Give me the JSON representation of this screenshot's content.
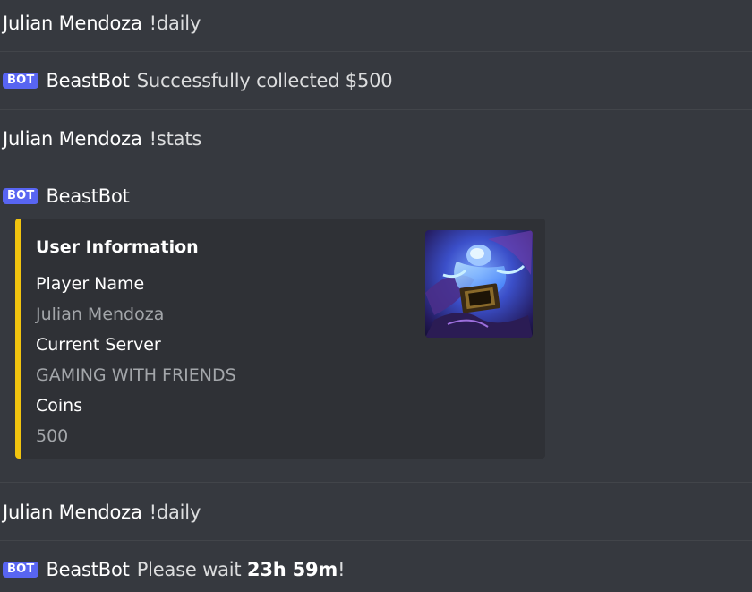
{
  "messages": [
    {
      "author": "Julian Mendoza",
      "text": "!daily"
    },
    {
      "bot_tag": "BOT",
      "author": "BeastBot",
      "text": "Successfully collected $500"
    },
    {
      "author": "Julian Mendoza",
      "text": "!stats"
    },
    {
      "bot_tag": "BOT",
      "author": "BeastBot"
    },
    {
      "author": "Julian Mendoza",
      "text": "!daily"
    },
    {
      "bot_tag": "BOT",
      "author": "BeastBot",
      "text_prefix": "Please wait ",
      "text_bold": "23h 59m",
      "text_suffix": "!"
    }
  ],
  "embed": {
    "accent_color": "#f1c40f",
    "title": "User Information",
    "fields": [
      {
        "name": "Player Name",
        "value": "Julian Mendoza"
      },
      {
        "name": "Current Server",
        "value": "GAMING WITH FRIENDS"
      },
      {
        "name": "Coins",
        "value": "500"
      }
    ],
    "thumbnail_icon": "fantasy-character-artwork"
  },
  "colors": {
    "background": "#36393f",
    "embed_background": "#2f3136",
    "bot_tag": "#5865f2"
  }
}
